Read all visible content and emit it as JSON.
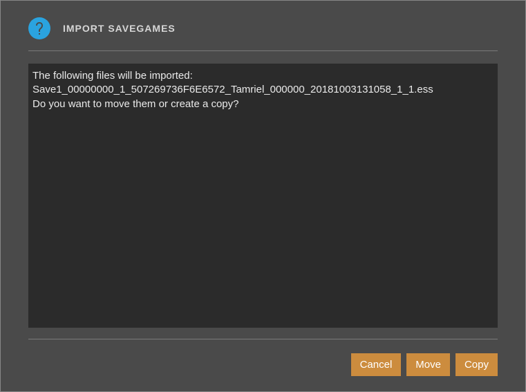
{
  "header": {
    "title": "IMPORT SAVEGAMES",
    "icon": "question-mark-icon"
  },
  "content": {
    "intro": "The following files will be imported:",
    "files": [
      "Save1_00000000_1_507269736F6E6572_Tamriel_000000_20181003131058_1_1.ess"
    ],
    "prompt": "Do you want to move them or create a copy?"
  },
  "buttons": {
    "cancel": "Cancel",
    "move": "Move",
    "copy": "Copy"
  },
  "colors": {
    "accent": "#cc8c3e",
    "icon_bg": "#2aa3df",
    "dialog_bg": "#4a4a4a",
    "content_bg": "#2b2b2b"
  }
}
